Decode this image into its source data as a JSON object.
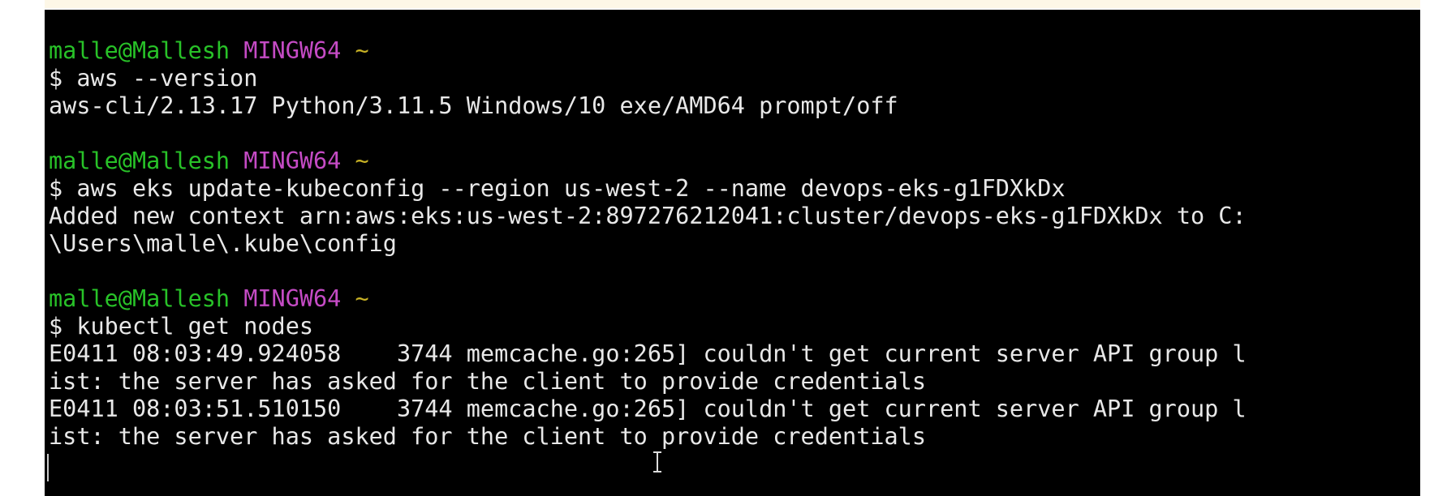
{
  "terminal": {
    "prompts": [
      {
        "user": "malle@Mallesh",
        "host": "MINGW64",
        "dir": "~"
      },
      {
        "user": "malle@Mallesh",
        "host": "MINGW64",
        "dir": "~"
      },
      {
        "user": "malle@Mallesh",
        "host": "MINGW64",
        "dir": "~"
      }
    ],
    "commands": [
      "$ aws --version",
      "$ aws eks update-kubeconfig --region us-west-2 --name devops-eks-g1FDXkDx",
      "$ kubectl get nodes"
    ],
    "outputs": {
      "aws_version": "aws-cli/2.13.17 Python/3.11.5 Windows/10 exe/AMD64 prompt/off",
      "kubeconfig_1": "Added new context arn:aws:eks:us-west-2:897276212041:cluster/devops-eks-g1FDXkDx to C:",
      "kubeconfig_2": "\\Users\\malle\\.kube\\config",
      "error_1a": "E0411 08:03:49.924058    3744 memcache.go:265] couldn't get current server API group l",
      "error_1b": "ist: the server has asked for the client to provide credentials",
      "error_2a": "E0411 08:03:51.510150    3744 memcache.go:265] couldn't get current server API group l",
      "error_2b": "ist: the server has asked for the client to provide credentials"
    }
  },
  "colors": {
    "background": "#000000",
    "text": "#e8e8e8",
    "user": "#28c228",
    "host": "#c54bc5",
    "dir": "#c8b225"
  },
  "icons": {
    "mouse_cursor": "text-ibeam-cursor-icon"
  }
}
